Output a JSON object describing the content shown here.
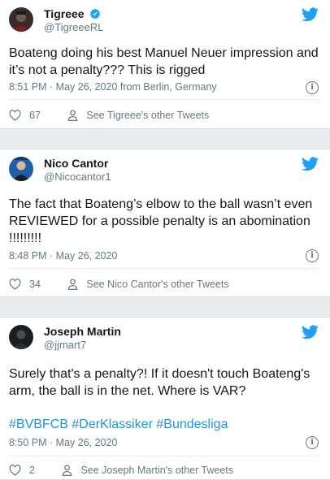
{
  "tweets": [
    {
      "name": "Tigreee",
      "handle": "@TigreeeRL",
      "text_lines": [
        "Boateng doing his best Manuel Neuer impression and",
        "it’s not a penalty??? This is rigged"
      ],
      "hashtags": "",
      "timestamp": "8:51 PM · May 26, 2020 from Berlin, Germany",
      "likes": "67",
      "other_tweets": "See Tigreee's other Tweets",
      "icons": [
        "verified-badge-icon",
        "twitter-bird-icon",
        "info-icon",
        "heart-icon",
        "person-icon"
      ]
    },
    {
      "name": "Nico Cantor",
      "handle": "@Nicocantor1",
      "text_lines": [
        "The fact that Boateng’s elbow to the ball wasn’t even",
        "REVIEWED for a possible penalty is an abomination",
        "!!!!!!!!!"
      ],
      "hashtags": "",
      "timestamp": "8:48 PM · May 26, 2020",
      "likes": "34",
      "other_tweets": "See Nico Cantor's other Tweets",
      "icons": [
        "twitter-bird-icon",
        "info-icon",
        "heart-icon",
        "person-icon"
      ]
    },
    {
      "name": "Joseph Martin",
      "handle": "@jjmart7",
      "text_lines": [
        "Surely that's a penalty?! If it doesn't touch Boateng's",
        "arm, the ball is in the net. Where is VAR?"
      ],
      "hashtags": "#BVBFCB #DerKlassiker #Bundesliga",
      "timestamp": "8:50 PM · May 26, 2020",
      "likes": "2",
      "other_tweets": "See Joseph Martin's other Tweets",
      "icons": [
        "twitter-bird-icon",
        "info-icon",
        "heart-icon",
        "person-icon"
      ]
    }
  ],
  "colors": {
    "twitter_blue": "#1da1f2",
    "hashtag_blue": "#1b95e0",
    "meta_gray": "#657786",
    "text": "#14171a"
  }
}
